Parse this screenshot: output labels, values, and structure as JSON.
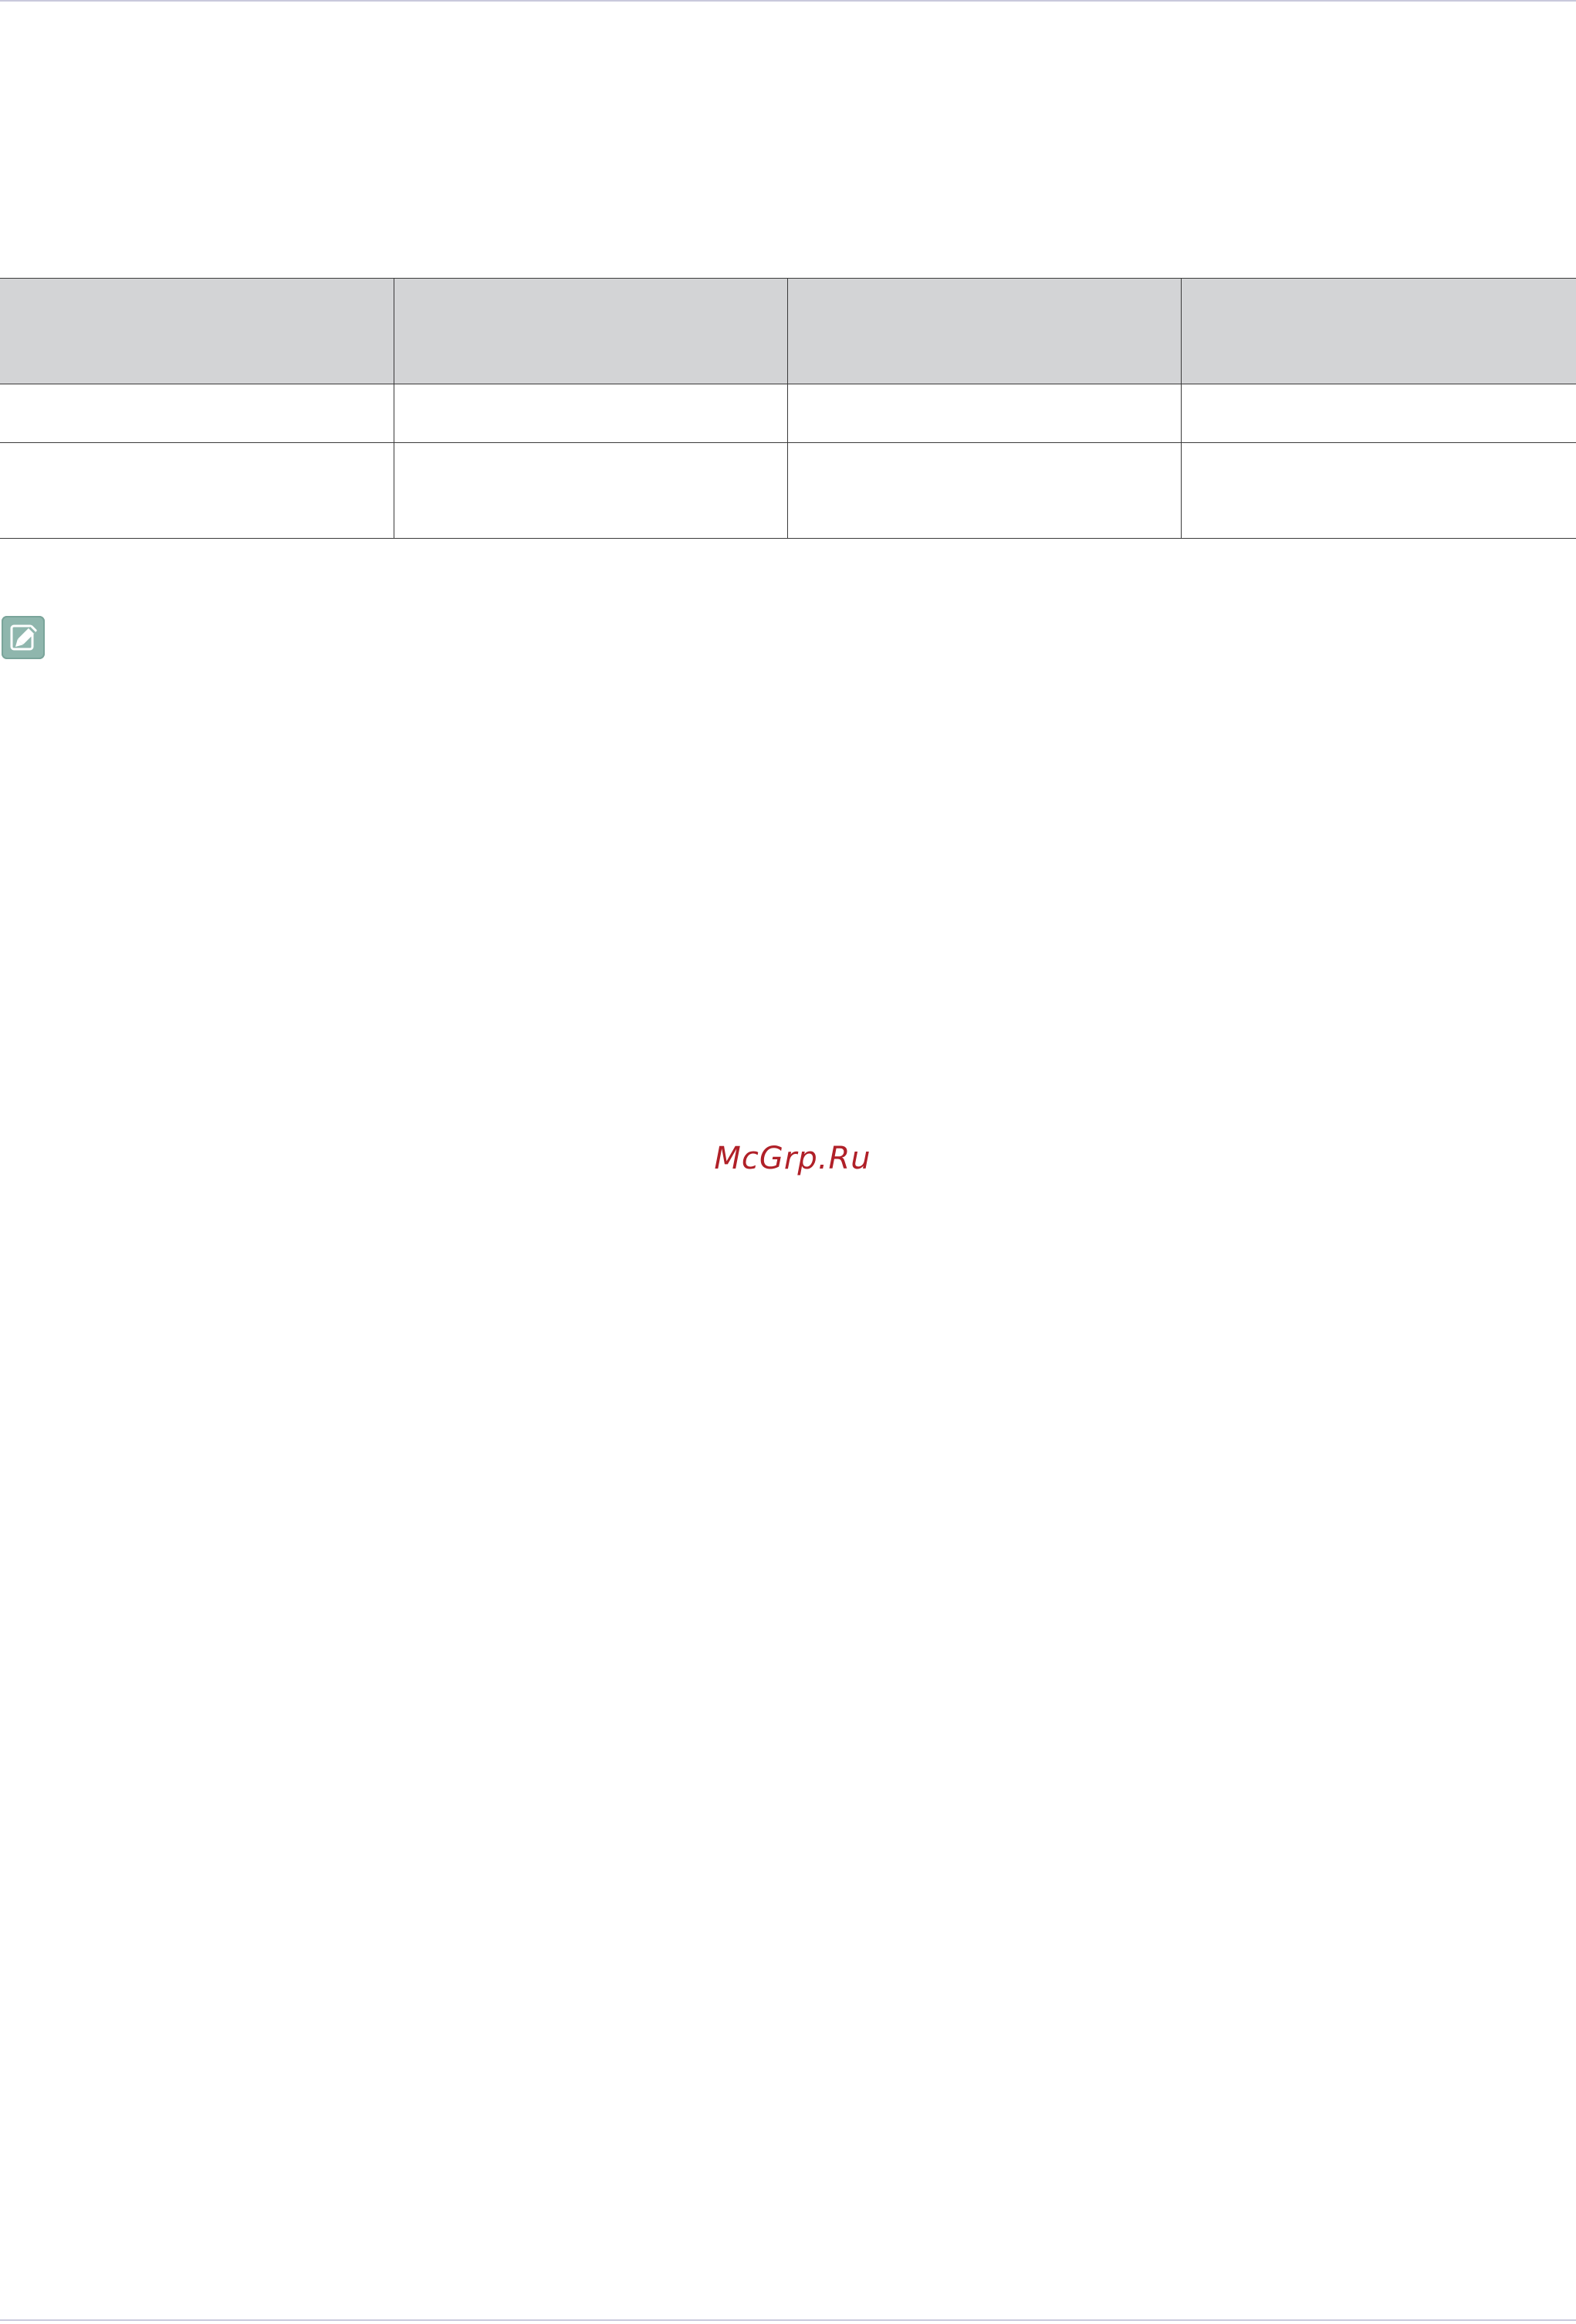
{
  "document": {
    "table": {
      "header": [
        "",
        "",
        "",
        ""
      ],
      "rows": [
        [
          "",
          "",
          "",
          ""
        ],
        [
          "",
          "",
          "",
          ""
        ]
      ]
    },
    "note_icon": "pencil-note-icon",
    "watermark": "McGrp.Ru",
    "colors": {
      "table_header_bg": "#d3d4d6",
      "table_border": "#3a3a3a",
      "note_icon_bg": "#8fb6ad",
      "watermark": "#b02028",
      "page_rule": "#c9c9dc"
    }
  }
}
